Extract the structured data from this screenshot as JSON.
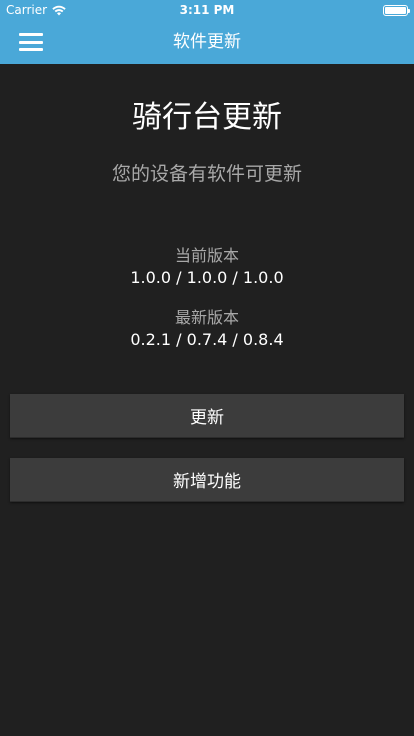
{
  "status_bar": {
    "carrier": "Carrier",
    "time": "3:11 PM",
    "wifi_icon": "wifi-icon",
    "battery_icon": "battery-icon"
  },
  "nav": {
    "menu_icon": "hamburger-menu-icon",
    "title": "软件更新"
  },
  "main": {
    "title": "骑行台更新",
    "subtitle": "您的设备有软件可更新",
    "current_version_label": "当前版本",
    "current_version_value": "1.0.0 / 1.0.0 / 1.0.0",
    "latest_version_label": "最新版本",
    "latest_version_value": "0.2.1 / 0.7.4 / 0.8.4",
    "update_button": "更新",
    "features_button": "新增功能"
  },
  "colors": {
    "header": "#4aa8d8",
    "background": "#202020",
    "button": "#3c3c3c",
    "muted_text": "#a8a8a8"
  }
}
